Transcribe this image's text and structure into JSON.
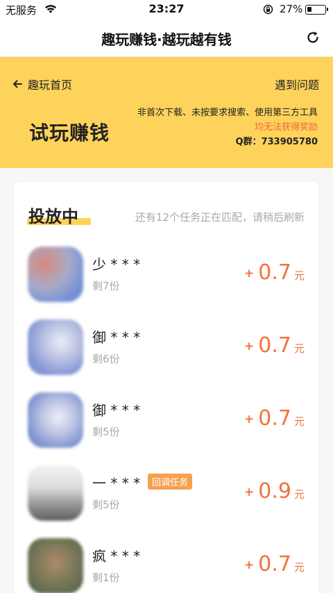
{
  "status_bar": {
    "carrier": "无服务",
    "time": "23:27",
    "battery_percent_text": "27%",
    "battery_level": 0.27
  },
  "nav": {
    "title": "趣玩赚钱·越玩越有钱",
    "refresh_icon": "refresh-icon"
  },
  "banner": {
    "back_label": "趣玩首页",
    "help_label": "遇到问题",
    "title": "试玩赚钱",
    "note_line1": "非首次下载、未按要求搜索、使用第三方工具",
    "note_line2": "均无法获得奖励",
    "note_line3": "Q群：733905780",
    "background_color": "#fdd35c",
    "warning_color": "#f2663a"
  },
  "section": {
    "title": "投放中",
    "hint": "还有12个任务正在匹配，请稍后刷新"
  },
  "tasks": [
    {
      "name": "少 * * *",
      "tag": "",
      "remain": "剩7份",
      "plus": "+",
      "amount": "0.7",
      "unit": "元"
    },
    {
      "name": "御 * * *",
      "tag": "",
      "remain": "剩6份",
      "plus": "+",
      "amount": "0.7",
      "unit": "元"
    },
    {
      "name": "御 * * *",
      "tag": "",
      "remain": "剩5份",
      "plus": "+",
      "amount": "0.7",
      "unit": "元"
    },
    {
      "name": "一 * * *",
      "tag": "回调任务",
      "remain": "剩5份",
      "plus": "+",
      "amount": "0.9",
      "unit": "元"
    },
    {
      "name": "疯 * * *",
      "tag": "",
      "remain": "剩1份",
      "plus": "+",
      "amount": "0.7",
      "unit": "元"
    }
  ],
  "colors": {
    "accent_orange": "#f2713a",
    "tag_orange": "#f7a04f",
    "muted_text": "#a8a8a8"
  }
}
